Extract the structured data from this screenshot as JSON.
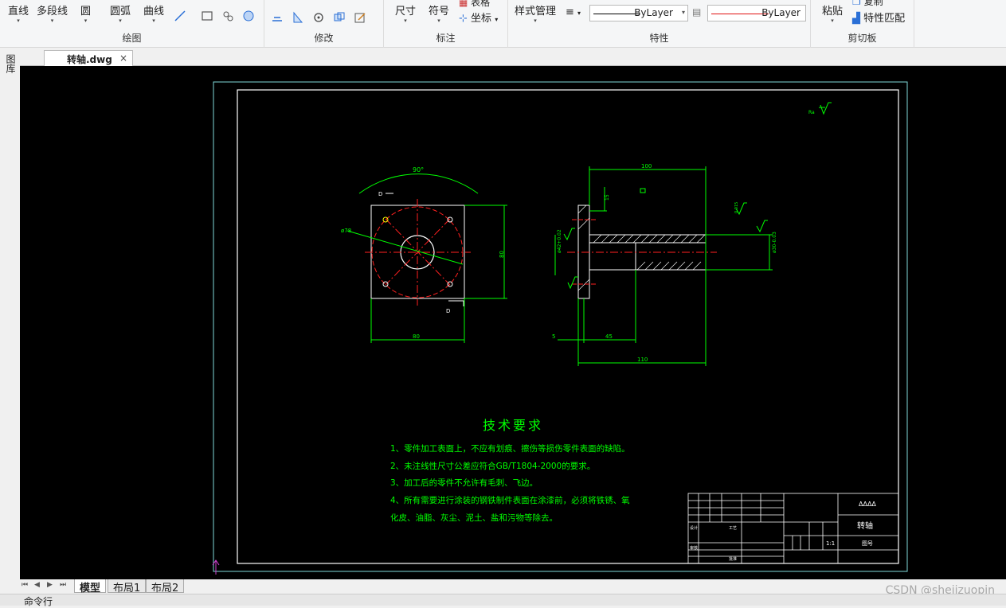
{
  "ribbon": {
    "draw": {
      "label": "绘图",
      "line": "直线",
      "polyline": "多段线",
      "circle": "圆",
      "arc": "圆弧",
      "curve": "曲线"
    },
    "modify": {
      "label": "修改"
    },
    "annotate": {
      "label": "标注",
      "dimension": "尺寸",
      "symbol": "符号",
      "table": "表格",
      "coordinate": "坐标"
    },
    "properties": {
      "label": "特性",
      "style_manager": "样式管理",
      "linetype": "ByLayer",
      "color": "ByLayer"
    },
    "clipboard": {
      "label": "剪切板",
      "paste": "粘贴",
      "copy": "复制",
      "match_props": "特性匹配"
    }
  },
  "leftbar": {
    "label": "图库"
  },
  "document": {
    "tab_name": "转轴.dwg",
    "close": "×"
  },
  "layout_tabs": [
    "模型",
    "布局1",
    "布局2"
  ],
  "nav": [
    "⏮",
    "◀",
    "▶",
    "⏭"
  ],
  "command_line": "命令行",
  "watermark": "CSDN @shejizuopin",
  "drawing": {
    "left_view": {
      "angle_dim": "90°",
      "diameter_dim": "ø78",
      "height_dim": "80",
      "width_dim": "80",
      "datum_label": "D"
    },
    "front_view": {
      "length_100": "100",
      "length_110": "110",
      "dim_45": "45",
      "dim_5": "5",
      "dim_15": "15",
      "dia_shaft": "ø30-0.03",
      "dia_flange": "ø42+0.02",
      "roughness_label": "Ra",
      "tol_1": "0.015"
    },
    "corner_roughness": "Ra",
    "tech_title": "技术要求",
    "tech_notes": [
      "1、零件加工表面上，不应有划痕、擦伤等损伤零件表面的缺陷。",
      "2、未注线性尺寸公差应符合GB/T1804-2000的要求。",
      "3、加工后的零件不允许有毛刺、飞边。",
      "4、所有需要进行涂装的钢铁制件表面在涂漆前，必须将铁锈、氧",
      "化皮、油脂、灰尘、泥土、盐和污物等除去。"
    ],
    "title_block": {
      "company": "ΔΔΔΔ",
      "part_name": "转轴",
      "drawing_no": "图号",
      "scale": "1:1",
      "designer": "设计",
      "checker": "审核",
      "process": "工艺",
      "approve": "批准"
    }
  },
  "colors": {
    "canvas_bg": "#000000",
    "cad_green": "#00ff00",
    "cad_red": "#ff0000",
    "cad_cyan": "#00ffff",
    "cad_white": "#ffffff",
    "cad_yellow": "#ffff00"
  }
}
